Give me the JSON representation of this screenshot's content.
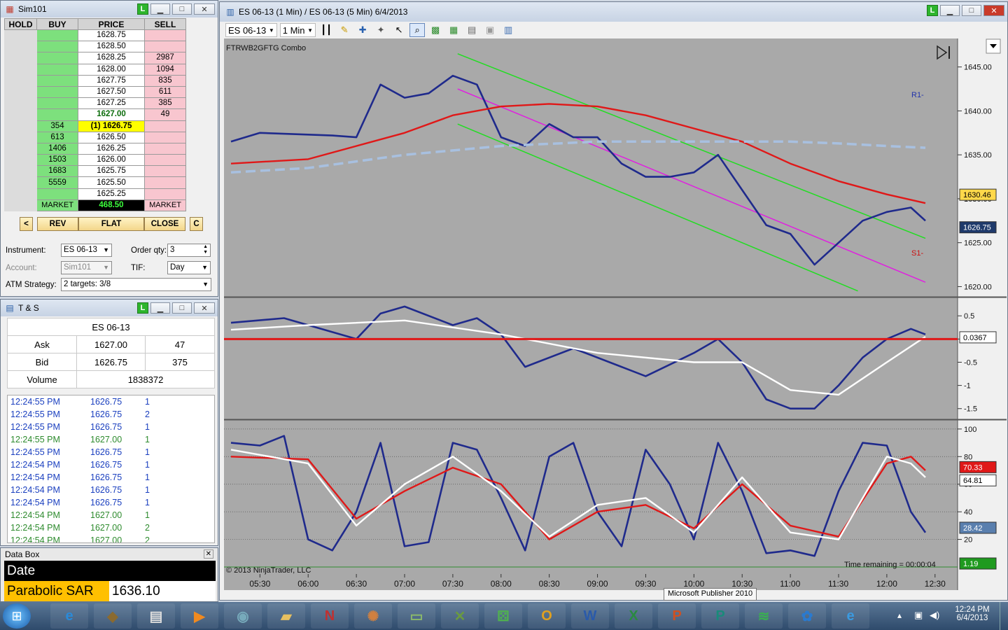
{
  "dom": {
    "title": "Sim101",
    "headers": [
      "HOLD",
      "BUY",
      "PRICE",
      "SELL"
    ],
    "rows": [
      {
        "buy": "",
        "price": "1628.75",
        "sell": ""
      },
      {
        "buy": "",
        "price": "1628.50",
        "sell": ""
      },
      {
        "buy": "",
        "price": "1628.25",
        "sell": "2987"
      },
      {
        "buy": "",
        "price": "1628.00",
        "sell": "1094"
      },
      {
        "buy": "",
        "price": "1627.75",
        "sell": "835"
      },
      {
        "buy": "",
        "price": "1627.50",
        "sell": "611"
      },
      {
        "buy": "",
        "price": "1627.25",
        "sell": "385"
      },
      {
        "buy": "",
        "price": "1627.00",
        "sell": "49"
      },
      {
        "buy": "354",
        "price": "(1) 1626.75",
        "sell": ""
      },
      {
        "buy": "613",
        "price": "1626.50",
        "sell": ""
      },
      {
        "buy": "1406",
        "price": "1626.25",
        "sell": ""
      },
      {
        "buy": "1503",
        "price": "1626.00",
        "sell": ""
      },
      {
        "buy": "1683",
        "price": "1625.75",
        "sell": ""
      },
      {
        "buy": "5559",
        "price": "1625.50",
        "sell": ""
      },
      {
        "buy": "",
        "price": "1625.25",
        "sell": ""
      }
    ],
    "market_buy": "MARKET",
    "pnl": "468.50",
    "market_sell": "MARKET",
    "buttons": {
      "left": "<",
      "rev": "REV",
      "flat": "FLAT",
      "close": "CLOSE",
      "c": "C"
    },
    "instrument_label": "Instrument:",
    "instrument": "ES 06-13",
    "order_qty_label": "Order qty:",
    "order_qty": "3",
    "account_label": "Account:",
    "account": "Sim101",
    "tif_label": "TIF:",
    "tif": "Day",
    "atm_label": "ATM Strategy:",
    "atm": "2 targets: 3/8"
  },
  "ts": {
    "title": "T & S",
    "instrument": "ES 06-13",
    "ask_label": "Ask",
    "ask_price": "1627.00",
    "ask_size": "47",
    "bid_label": "Bid",
    "bid_price": "1626.75",
    "bid_size": "375",
    "volume_label": "Volume",
    "volume": "1838372",
    "trades": [
      {
        "time": "12:24:55 PM",
        "price": "1626.75",
        "size": "1",
        "color": "#1a3fbf"
      },
      {
        "time": "12:24:55 PM",
        "price": "1626.75",
        "size": "2",
        "color": "#1a3fbf"
      },
      {
        "time": "12:24:55 PM",
        "price": "1626.75",
        "size": "1",
        "color": "#1a3fbf"
      },
      {
        "time": "12:24:55 PM",
        "price": "1627.00",
        "size": "1",
        "color": "#2e8b2e"
      },
      {
        "time": "12:24:55 PM",
        "price": "1626.75",
        "size": "1",
        "color": "#1a3fbf"
      },
      {
        "time": "12:24:54 PM",
        "price": "1626.75",
        "size": "1",
        "color": "#1a3fbf"
      },
      {
        "time": "12:24:54 PM",
        "price": "1626.75",
        "size": "1",
        "color": "#1a3fbf"
      },
      {
        "time": "12:24:54 PM",
        "price": "1626.75",
        "size": "1",
        "color": "#1a3fbf"
      },
      {
        "time": "12:24:54 PM",
        "price": "1626.75",
        "size": "1",
        "color": "#1a3fbf"
      },
      {
        "time": "12:24:54 PM",
        "price": "1627.00",
        "size": "1",
        "color": "#2e8b2e"
      },
      {
        "time": "12:24:54 PM",
        "price": "1627.00",
        "size": "2",
        "color": "#2e8b2e"
      },
      {
        "time": "12:24:54 PM",
        "price": "1627.00",
        "size": "2",
        "color": "#2e8b2e"
      }
    ]
  },
  "databox": {
    "title": "Data Box",
    "date_label": "Date",
    "date_value": "",
    "psar_label": "Parabolic SAR",
    "psar_value": "1636.10"
  },
  "chart": {
    "title": "ES 06-13 (1 Min) / ES 06-13 (5 Min)  6/4/2013",
    "instrument": "ES 06-13",
    "interval": "1 Min",
    "indicator_label": "FTRWB2GFTG Combo",
    "copyright": "© 2013 NinjaTrader, LLC",
    "time_remaining": "Time remaining = 00:00:04",
    "r1_label": "R1-",
    "s1_label": "S1-"
  },
  "taskbar": {
    "tooltip": "Microsoft Publisher 2010",
    "clock_time": "12:24 PM",
    "clock_date": "6/4/2013"
  },
  "chart_data": [
    {
      "type": "line",
      "name": "price-panel",
      "x_ticks": [
        "05:30",
        "06:00",
        "06:30",
        "07:00",
        "07:30",
        "08:00",
        "08:30",
        "09:00",
        "09:30",
        "10:00",
        "10:30",
        "11:00",
        "11:30",
        "12:00",
        "12:30"
      ],
      "y_ticks": [
        1645.0,
        1640.0,
        1635.0,
        1630.0,
        1625.0,
        1620.0
      ],
      "ylim": [
        1619,
        1648
      ],
      "series": [
        {
          "name": "price",
          "color": "#1f2a8c",
          "x": [
            5.2,
            5.5,
            6.0,
            6.25,
            6.5,
            6.75,
            7.0,
            7.25,
            7.5,
            7.75,
            8.0,
            8.25,
            8.5,
            8.75,
            9.0,
            9.25,
            9.5,
            9.75,
            10.0,
            10.25,
            10.5,
            10.75,
            11.0,
            11.25,
            11.5,
            11.75,
            12.0,
            12.25,
            12.4
          ],
          "y": [
            1636.5,
            1637.5,
            1637.3,
            1637.2,
            1637.0,
            1643.0,
            1641.5,
            1642.0,
            1644.0,
            1643.0,
            1637.0,
            1636.0,
            1638.5,
            1637.0,
            1637.0,
            1634.0,
            1632.5,
            1632.5,
            1633.0,
            1635.0,
            1631.0,
            1627.0,
            1626.0,
            1622.5,
            1625.0,
            1627.5,
            1628.5,
            1629.0,
            1627.5
          ]
        },
        {
          "name": "ma-red",
          "color": "#e01818",
          "x": [
            5.2,
            6.0,
            7.0,
            7.5,
            8.0,
            8.5,
            9.0,
            9.5,
            10.0,
            10.5,
            11.0,
            11.5,
            12.0,
            12.4
          ],
          "y": [
            1634.0,
            1634.5,
            1637.5,
            1639.5,
            1640.5,
            1640.8,
            1640.5,
            1639.5,
            1638.0,
            1636.5,
            1634.0,
            1632.0,
            1630.5,
            1629.5
          ]
        },
        {
          "name": "ma-dashed",
          "color": "#a8c0e0",
          "x": [
            5.2,
            6.0,
            7.0,
            8.0,
            9.0,
            10.0,
            11.0,
            11.5,
            12.0,
            12.4
          ],
          "y": [
            1633.0,
            1633.5,
            1635.0,
            1636.0,
            1636.5,
            1636.5,
            1636.5,
            1636.3,
            1636.0,
            1635.8
          ]
        }
      ],
      "markers": {
        "current_price": "1626.75",
        "level": "1630.46"
      }
    },
    {
      "type": "area",
      "name": "macd-panel",
      "y_ticks": [
        0.5,
        0,
        -0.5,
        -1,
        -1.5
      ],
      "ylim": [
        -1.7,
        0.85
      ],
      "current": "0.0367",
      "series": [
        {
          "name": "macd",
          "color": "#1f2a8c",
          "x": [
            5.2,
            5.75,
            6.5,
            6.75,
            7.0,
            7.5,
            7.75,
            8.0,
            8.25,
            8.75,
            9.25,
            9.5,
            9.75,
            10.0,
            10.25,
            10.5,
            10.75,
            11.0,
            11.25,
            11.5,
            11.75,
            12.0,
            12.25,
            12.4
          ],
          "y": [
            0.35,
            0.45,
            0.0,
            0.55,
            0.7,
            0.3,
            0.45,
            0.1,
            -0.6,
            -0.2,
            -0.6,
            -0.8,
            -0.55,
            -0.3,
            0.0,
            -0.5,
            -1.3,
            -1.5,
            -1.5,
            -1.0,
            -0.4,
            0.0,
            0.22,
            0.1
          ]
        },
        {
          "name": "signal",
          "color": "#ffffff",
          "x": [
            5.2,
            6.0,
            7.0,
            8.0,
            9.0,
            10.0,
            10.5,
            11.0,
            11.5,
            12.0,
            12.4
          ],
          "y": [
            0.2,
            0.3,
            0.4,
            0.1,
            -0.3,
            -0.5,
            -0.5,
            -1.1,
            -1.2,
            -0.5,
            0.05
          ]
        }
      ]
    },
    {
      "type": "line",
      "name": "stochastic-panel",
      "y_ticks": [
        100,
        80,
        60,
        40,
        20
      ],
      "ylim": [
        0,
        105
      ],
      "values_shown": {
        "red": "70.33",
        "white": "64.81",
        "blue": "28.42",
        "green": "1.19"
      },
      "series": [
        {
          "name": "stoch-blue",
          "color": "#1f2a8c",
          "x": [
            5.2,
            5.5,
            5.75,
            6.0,
            6.25,
            6.5,
            6.75,
            7.0,
            7.25,
            7.5,
            7.75,
            8.0,
            8.25,
            8.5,
            8.75,
            9.0,
            9.25,
            9.5,
            9.75,
            10.0,
            10.25,
            10.5,
            10.75,
            11.0,
            11.25,
            11.5,
            11.75,
            12.0,
            12.25,
            12.4
          ],
          "y": [
            90,
            88,
            95,
            20,
            12,
            40,
            90,
            15,
            18,
            90,
            85,
            50,
            12,
            80,
            90,
            40,
            15,
            85,
            60,
            20,
            90,
            55,
            10,
            12,
            8,
            55,
            90,
            88,
            40,
            25
          ]
        },
        {
          "name": "stoch-red",
          "color": "#e01818",
          "x": [
            5.2,
            6.0,
            6.5,
            7.0,
            7.5,
            8.0,
            8.5,
            9.0,
            9.5,
            10.0,
            10.5,
            11.0,
            11.5,
            12.0,
            12.25,
            12.4
          ],
          "y": [
            80,
            78,
            35,
            55,
            72,
            60,
            20,
            40,
            45,
            28,
            60,
            30,
            22,
            75,
            80,
            70
          ]
        },
        {
          "name": "stoch-white",
          "color": "#ffffff",
          "x": [
            5.2,
            6.0,
            6.5,
            7.0,
            7.5,
            8.0,
            8.5,
            9.0,
            9.5,
            10.0,
            10.5,
            11.0,
            11.5,
            12.0,
            12.25,
            12.4
          ],
          "y": [
            85,
            75,
            30,
            60,
            80,
            55,
            22,
            45,
            50,
            25,
            65,
            25,
            20,
            80,
            75,
            65
          ]
        }
      ]
    }
  ]
}
